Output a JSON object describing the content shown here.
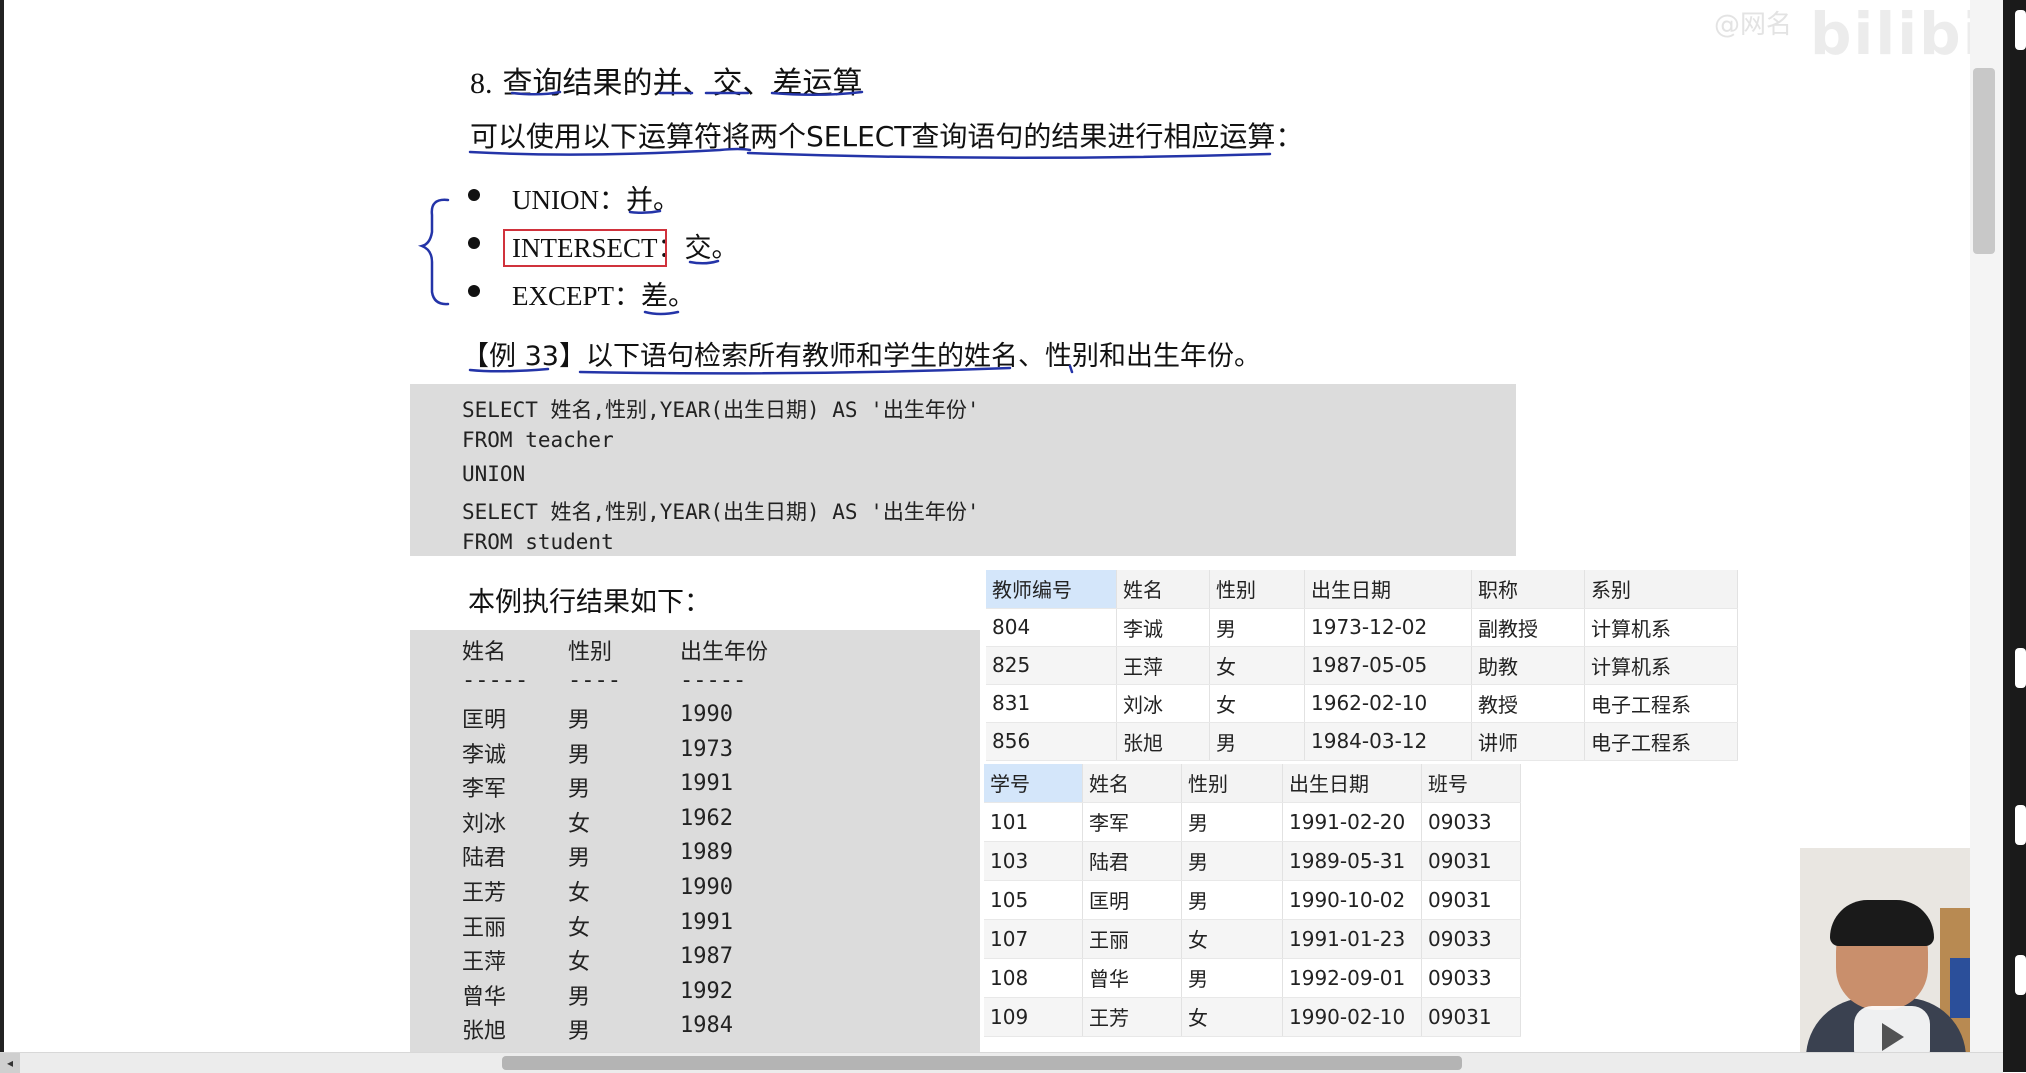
{
  "overlay": {
    "watermark": "bilibili",
    "watermark_small": "@网名"
  },
  "doc": {
    "heading_number": "8.",
    "heading_text": "查询结果的并、交、差运算",
    "intro": "可以使用以下运算符将两个SELECT查询语句的结果进行相应运算：",
    "operators": [
      {
        "text": "UNION：并。"
      },
      {
        "text": "INTERSECT：交。"
      },
      {
        "text": "EXCEPT：差。"
      }
    ],
    "example": "【例 33】以下语句检索所有教师和学生的姓名、性别和出生年份。",
    "code_lines": [
      "SELECT 姓名,性别,YEAR(出生日期) AS '出生年份'",
      "FROM teacher",
      "UNION",
      "SELECT 姓名,性别,YEAR(出生日期) AS '出生年份'",
      "FROM student"
    ],
    "result_intro": "本例执行结果如下：",
    "result_headers": [
      "姓名",
      "性别",
      "出生年份"
    ],
    "result_separators": [
      "-----",
      "----",
      "-----"
    ],
    "result_rows": [
      [
        "匡明",
        "男",
        "1990"
      ],
      [
        "李诚",
        "男",
        "1973"
      ],
      [
        "李军",
        "男",
        "1991"
      ],
      [
        "刘冰",
        "女",
        "1962"
      ],
      [
        "陆君",
        "男",
        "1989"
      ],
      [
        "王芳",
        "女",
        "1990"
      ],
      [
        "王丽",
        "女",
        "1991"
      ],
      [
        "王萍",
        "女",
        "1987"
      ],
      [
        "曾华",
        "男",
        "1992"
      ],
      [
        "张旭",
        "男",
        "1984"
      ]
    ]
  },
  "teacher_table": {
    "headers": [
      "教师编号",
      "姓名",
      "性别",
      "出生日期",
      "职称",
      "系别"
    ],
    "rows": [
      [
        "804",
        "李诚",
        "男",
        "1973-12-02",
        "副教授",
        "计算机系"
      ],
      [
        "825",
        "王萍",
        "女",
        "1987-05-05",
        "助教",
        "计算机系"
      ],
      [
        "831",
        "刘冰",
        "女",
        "1962-02-10",
        "教授",
        "电子工程系"
      ],
      [
        "856",
        "张旭",
        "男",
        "1984-03-12",
        "讲师",
        "电子工程系"
      ]
    ]
  },
  "student_table": {
    "headers": [
      "学号",
      "姓名",
      "性别",
      "出生日期",
      "班号"
    ],
    "rows": [
      [
        "101",
        "李军",
        "男",
        "1991-02-20",
        "09033"
      ],
      [
        "103",
        "陆君",
        "男",
        "1989-05-31",
        "09031"
      ],
      [
        "105",
        "匡明",
        "男",
        "1990-10-02",
        "09031"
      ],
      [
        "107",
        "王丽",
        "女",
        "1991-01-23",
        "09033"
      ],
      [
        "108",
        "曾华",
        "男",
        "1992-09-01",
        "09033"
      ],
      [
        "109",
        "王芳",
        "女",
        "1990-02-10",
        "09031"
      ]
    ]
  },
  "colors": {
    "annotation_blue": "#2434a8",
    "annotation_red": "#d0323c",
    "selected_header": "#d4e6fa"
  }
}
